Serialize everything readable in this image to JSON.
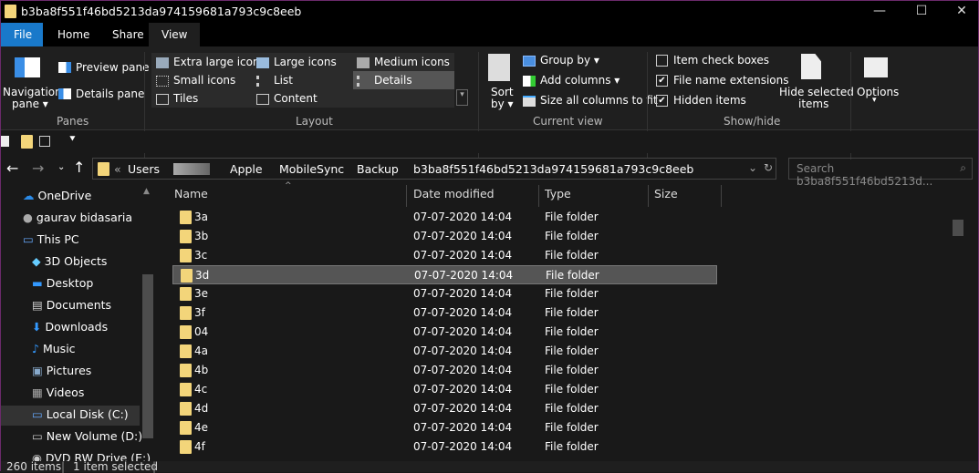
{
  "window": {
    "title": "b3ba8f551f46bd5213da974159681a793c9c8eeb",
    "minimize": "—",
    "maximize": "☐",
    "close": "✕"
  },
  "tabs": [
    "File",
    "Home",
    "Share",
    "View"
  ],
  "ribbon": {
    "panes": {
      "navigation_pane": "Navigation",
      "navigation_pane2": "pane ▾",
      "preview_pane": "Preview pane",
      "details_pane": "Details pane",
      "group": "Panes"
    },
    "layout": {
      "items": [
        "Extra large icons",
        "Large icons",
        "Medium icons",
        "Small icons",
        "List",
        "Details",
        "Tiles",
        "Content"
      ],
      "group": "Layout",
      "selected": "Details"
    },
    "current_view": {
      "sort_by": "Sort",
      "sort_by2": "by ▾",
      "group_by": "Group by ▾",
      "add_columns": "Add columns ▾",
      "size_columns": "Size all columns to fit",
      "group": "Current view"
    },
    "show_hide": {
      "item_check_boxes": "Item check boxes",
      "file_name_extensions": "File name extensions",
      "hidden_items": "Hidden items",
      "hide_selected": "Hide selected",
      "hide_selected2": "items",
      "group": "Show/hide",
      "checks": [
        false,
        true,
        true
      ]
    },
    "options": {
      "label": "Options",
      "arrow": "▾"
    }
  },
  "address": {
    "prefix": "«",
    "crumbs": [
      "Users",
      "Apple",
      "MobileSync",
      "Backup",
      "b3ba8f551f46bd5213da974159681a793c9c8eeb"
    ],
    "search_placeholder": "Search b3ba8f551f46bd5213d..."
  },
  "sidebar": [
    "OneDrive",
    "gaurav bidasaria",
    "This PC",
    "3D Objects",
    "Desktop",
    "Documents",
    "Downloads",
    "Music",
    "Pictures",
    "Videos",
    "Local Disk (C:)",
    "New Volume (D:)",
    "DVD RW Drive (E:)"
  ],
  "columns": [
    "Name",
    "Date modified",
    "Type",
    "Size"
  ],
  "files": [
    {
      "name": "3a",
      "date": "07-07-2020 14:04",
      "type": "File folder"
    },
    {
      "name": "3b",
      "date": "07-07-2020 14:04",
      "type": "File folder"
    },
    {
      "name": "3c",
      "date": "07-07-2020 14:04",
      "type": "File folder"
    },
    {
      "name": "3d",
      "date": "07-07-2020 14:04",
      "type": "File folder"
    },
    {
      "name": "3e",
      "date": "07-07-2020 14:04",
      "type": "File folder"
    },
    {
      "name": "3f",
      "date": "07-07-2020 14:04",
      "type": "File folder"
    },
    {
      "name": "04",
      "date": "07-07-2020 14:04",
      "type": "File folder"
    },
    {
      "name": "4a",
      "date": "07-07-2020 14:04",
      "type": "File folder"
    },
    {
      "name": "4b",
      "date": "07-07-2020 14:04",
      "type": "File folder"
    },
    {
      "name": "4c",
      "date": "07-07-2020 14:04",
      "type": "File folder"
    },
    {
      "name": "4d",
      "date": "07-07-2020 14:04",
      "type": "File folder"
    },
    {
      "name": "4e",
      "date": "07-07-2020 14:04",
      "type": "File folder"
    },
    {
      "name": "4f",
      "date": "07-07-2020 14:04",
      "type": "File folder"
    }
  ],
  "status": {
    "count": "260 items",
    "selected": "1 item selected"
  }
}
